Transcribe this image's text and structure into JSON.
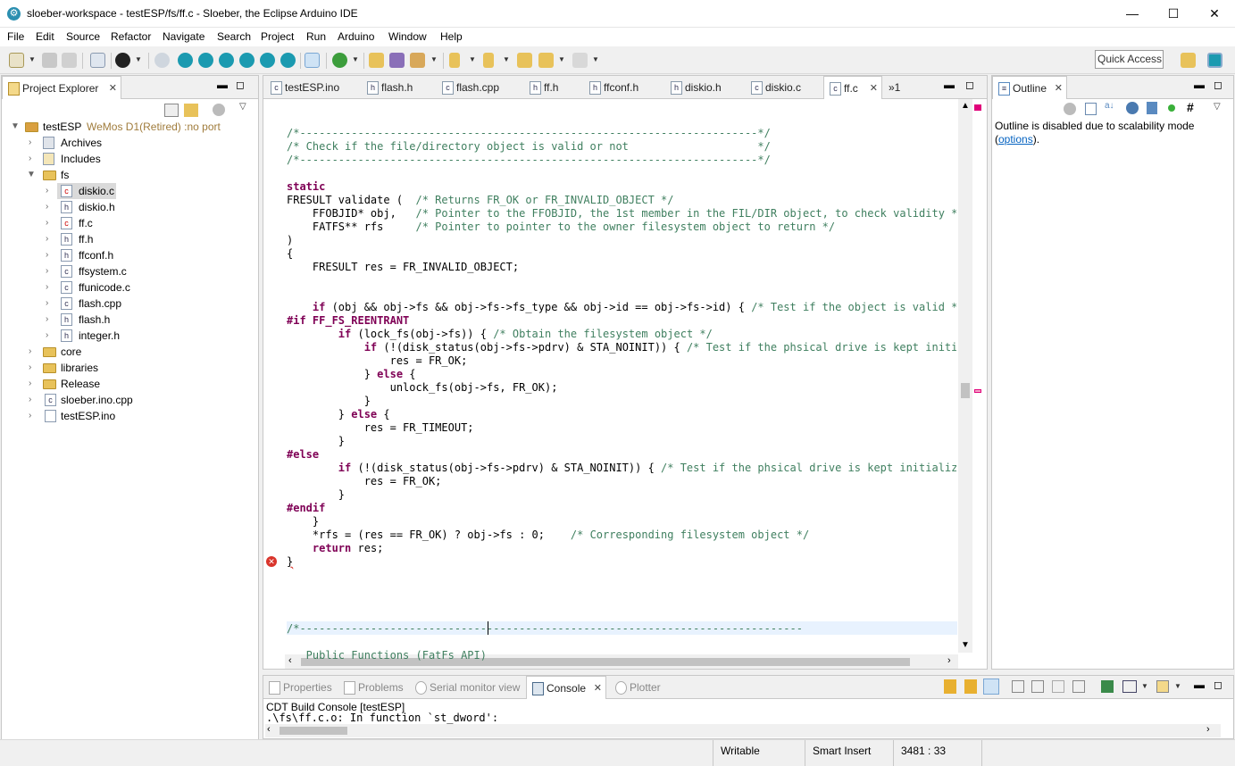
{
  "window": {
    "title": "sloeber-workspace - testESP/fs/ff.c - Sloeber, the Eclipse Arduino IDE",
    "minimize": "—",
    "maximize": "☐",
    "close": "✕"
  },
  "menu": [
    "File",
    "Edit",
    "Source",
    "Refactor",
    "Navigate",
    "Search",
    "Project",
    "Run",
    "Arduino",
    "Window",
    "Help"
  ],
  "toolbar": {
    "quick_access": "Quick Access"
  },
  "project_explorer": {
    "title": "Project Explorer",
    "project": {
      "name": "testESP",
      "board": "WeMos D1(Retired) :no port"
    },
    "items": [
      {
        "label": "Archives",
        "kind": "lib",
        "level": 1,
        "expanded": false
      },
      {
        "label": "Includes",
        "kind": "inc",
        "level": 1,
        "expanded": false
      },
      {
        "label": "fs",
        "kind": "folder-err",
        "level": 1,
        "expanded": true
      },
      {
        "label": "diskio.c",
        "kind": "c-err",
        "level": 2,
        "selected": true
      },
      {
        "label": "diskio.h",
        "kind": "h",
        "level": 2
      },
      {
        "label": "ff.c",
        "kind": "c-err",
        "level": 2
      },
      {
        "label": "ff.h",
        "kind": "h",
        "level": 2
      },
      {
        "label": "ffconf.h",
        "kind": "h",
        "level": 2
      },
      {
        "label": "ffsystem.c",
        "kind": "c",
        "level": 2
      },
      {
        "label": "ffunicode.c",
        "kind": "c",
        "level": 2
      },
      {
        "label": "flash.cpp",
        "kind": "c",
        "level": 2
      },
      {
        "label": "flash.h",
        "kind": "h",
        "level": 2
      },
      {
        "label": "integer.h",
        "kind": "h",
        "level": 2
      },
      {
        "label": "core",
        "kind": "folder",
        "level": 1
      },
      {
        "label": "libraries",
        "kind": "folder",
        "level": 1
      },
      {
        "label": "Release",
        "kind": "folder-err",
        "level": 1
      },
      {
        "label": "sloeber.ino.cpp",
        "kind": "c",
        "level": 1
      },
      {
        "label": "testESP.ino",
        "kind": "file",
        "level": 1
      }
    ]
  },
  "editor": {
    "tabs": [
      {
        "label": "testESP.ino",
        "icon": "c"
      },
      {
        "label": "flash.h",
        "icon": "h"
      },
      {
        "label": "flash.cpp",
        "icon": "c"
      },
      {
        "label": "ff.h",
        "icon": "h"
      },
      {
        "label": "ffconf.h",
        "icon": "h"
      },
      {
        "label": "diskio.h",
        "icon": "h"
      },
      {
        "label": "diskio.c",
        "icon": "c"
      },
      {
        "label": "ff.c",
        "icon": "c",
        "active": true
      }
    ],
    "overflow": "»1",
    "lines": [
      {
        "t": "/*-----------------------------------------------------------------------*/",
        "c": "cmt"
      },
      {
        "t": "/* Check if the file/directory object is valid or not                    */",
        "c": "cmt"
      },
      {
        "t": "/*-----------------------------------------------------------------------*/",
        "c": "cmt"
      },
      {
        "t": "",
        "c": ""
      },
      {
        "t": "static",
        "c": "kw"
      },
      {
        "t": "FRESULT validate (  ",
        "c": "",
        "tail": "/* Returns FR_OK or FR_INVALID_OBJECT */"
      },
      {
        "t": "    FFOBJID* obj,   ",
        "c": "",
        "tail": "/* Pointer to the FFOBJID, the 1st member in the FIL/DIR object, to check validity */"
      },
      {
        "t": "    FATFS** rfs     ",
        "c": "",
        "tail": "/* Pointer to pointer to the owner filesystem object to return */"
      },
      {
        "t": ")",
        "c": ""
      },
      {
        "t": "{",
        "c": ""
      },
      {
        "t": "    FRESULT res = FR_INVALID_OBJECT;",
        "c": ""
      },
      {
        "t": "",
        "c": ""
      },
      {
        "t": "",
        "c": ""
      },
      {
        "t": "    if (obj && obj->fs && obj->fs->fs_type && obj->id == obj->fs->id) { ",
        "c": "if",
        "tail": "/* Test if the object is valid */"
      },
      {
        "t": "#if FF_FS_REENTRANT",
        "c": "pre"
      },
      {
        "t": "        if (lock_fs(obj->fs)) { ",
        "c": "if",
        "tail": "/* Obtain the filesystem object */"
      },
      {
        "t": "            if (!(disk_status(obj->fs->pdrv) & STA_NOINIT)) { ",
        "c": "if",
        "tail": "/* Test if the phsical drive is kept initializ"
      },
      {
        "t": "                res = FR_OK;",
        "c": ""
      },
      {
        "t": "            } else {",
        "c": "else"
      },
      {
        "t": "                unlock_fs(obj->fs, FR_OK);",
        "c": ""
      },
      {
        "t": "            }",
        "c": ""
      },
      {
        "t": "        } else {",
        "c": "else"
      },
      {
        "t": "            res = FR_TIMEOUT;",
        "c": ""
      },
      {
        "t": "        }",
        "c": ""
      },
      {
        "t": "#else",
        "c": "pre"
      },
      {
        "t": "        if (!(disk_status(obj->fs->pdrv) & STA_NOINIT)) { ",
        "c": "if",
        "tail": "/* Test if the phsical drive is kept initialized *"
      },
      {
        "t": "            res = FR_OK;",
        "c": ""
      },
      {
        "t": "        }",
        "c": ""
      },
      {
        "t": "#endif",
        "c": "pre"
      },
      {
        "t": "    }",
        "c": ""
      },
      {
        "t": "    *rfs = (res == FR_OK) ? obj->fs : 0;    ",
        "c": "",
        "tail": "/* Corresponding filesystem object */"
      },
      {
        "t": "    return res;",
        "c": "ret"
      },
      {
        "t": "}",
        "c": "err"
      },
      {
        "t": "",
        "c": ""
      },
      {
        "t": "",
        "c": ""
      },
      {
        "t": "",
        "c": ""
      },
      {
        "t": "",
        "c": ""
      },
      {
        "t": "/*------------------------------------------------------------------------------",
        "c": "cmt"
      },
      {
        "t": "",
        "c": ""
      },
      {
        "t": "   Public Functions (FatFs API)",
        "c": "cmt"
      }
    ]
  },
  "outline": {
    "title": "Outline",
    "message": "Outline is disabled due to scalability mode (",
    "link": "options",
    "message_end": ")."
  },
  "bottom": {
    "tabs": [
      "Properties",
      "Problems",
      "Serial monitor view",
      "Console",
      "Plotter"
    ],
    "active": "Console",
    "console_title": "CDT Build Console [testESP]",
    "console_line": ".\\fs\\ff.c.o: In function `st_dword':"
  },
  "status": {
    "writable": "Writable",
    "insert": "Smart Insert",
    "position": "3481 : 33"
  },
  "colors": {
    "comment": "#3f7f5f",
    "keyword": "#7f0055",
    "error": "#d9342b",
    "link": "#0563c1"
  }
}
